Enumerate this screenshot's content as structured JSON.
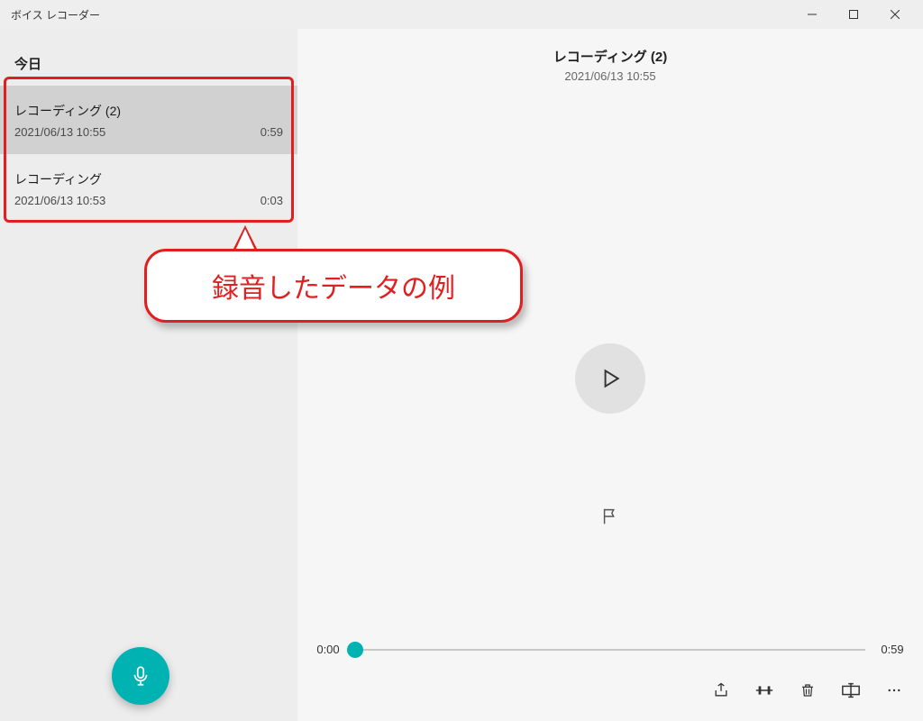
{
  "app": {
    "title": "ボイス レコーダー"
  },
  "sidebar": {
    "section": "今日",
    "recordings": [
      {
        "title": "レコーディング (2)",
        "datetime": "2021/06/13 10:55",
        "duration": "0:59",
        "selected": true
      },
      {
        "title": "レコーディング",
        "datetime": "2021/06/13 10:53",
        "duration": "0:03",
        "selected": false
      }
    ]
  },
  "detail": {
    "title": "レコーディング (2)",
    "subtitle": "2021/06/13 10:55",
    "timeline": {
      "start": "0:00",
      "end": "0:59"
    }
  },
  "callout": {
    "text": "録音したデータの例"
  },
  "icons": {
    "minimize": "minimize-icon",
    "maximize": "maximize-icon",
    "close": "close-icon",
    "play": "play-icon",
    "flag": "flag-icon",
    "share": "share-icon",
    "trim": "trim-icon",
    "delete": "delete-icon",
    "rename": "rename-icon",
    "more": "more-icon",
    "mic": "microphone-icon"
  }
}
